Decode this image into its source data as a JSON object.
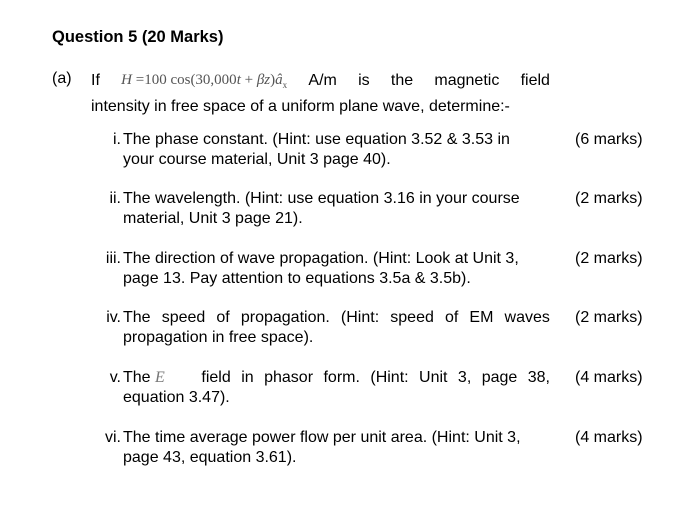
{
  "question": {
    "title": "Question 5 (20 Marks)",
    "part_label": "(a)",
    "intro": {
      "if_word": "If",
      "equation": {
        "lhs": "H",
        "equals": "=100 cos(30,000",
        "t": "t",
        "plus": " + ",
        "beta_z": "βz",
        "close": ")",
        "unit_vector": "â",
        "subscript": "x"
      },
      "line1_rest": [
        "A/m",
        "is",
        "the",
        "magnetic",
        "field"
      ],
      "line2": "intensity in free space of a uniform plane wave, determine:-"
    },
    "items": [
      {
        "num": "i.",
        "line1": "The phase constant. (Hint: use equation 3.52 & 3.53 in",
        "line2": "your course material, Unit 3 page 40).",
        "marks": "(6 marks)"
      },
      {
        "num": "ii.",
        "line1": "The wavelength. (Hint: use equation 3.16 in your course",
        "line2": "material, Unit 3 page 21).",
        "marks": "(2 marks)"
      },
      {
        "num": "iii.",
        "line1": "The direction of wave propagation. (Hint: Look at Unit 3,",
        "line2": "page 13. Pay attention to equations 3.5a & 3.5b).",
        "marks": "(2 marks)"
      },
      {
        "num": "iv.",
        "line1": "The speed of propagation. (Hint: speed of EM waves",
        "line2": "propagation in free space).",
        "marks": "(2 marks)"
      },
      {
        "num": "v.",
        "line1_pre": "The",
        "line1_symbol": "E",
        "line1_post": "field in phasor form. (Hint: Unit 3, page 38,",
        "line2": "equation 3.47).",
        "marks": "(4 marks)"
      },
      {
        "num": "vi.",
        "line1": "The time average power flow per unit area. (Hint: Unit 3,",
        "line2": "page 43, equation 3.61).",
        "marks": "(4 marks)"
      }
    ]
  }
}
